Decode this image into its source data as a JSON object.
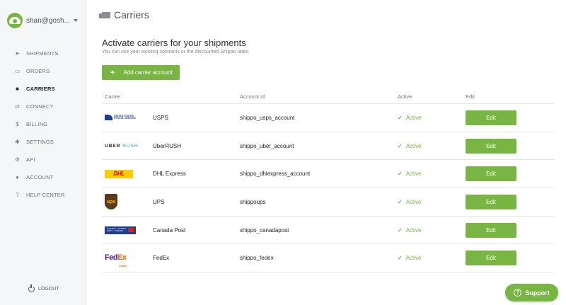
{
  "user": {
    "name": "shan@gosh...",
    "avatar_icon": "shippo-logo-icon"
  },
  "sidebar": {
    "items": [
      {
        "label": "SHIPMENTS",
        "icon": "paper-plane-icon",
        "glyph": "➤"
      },
      {
        "label": "ORDERS",
        "icon": "inbox-icon",
        "glyph": "▭"
      },
      {
        "label": "CARRIERS",
        "icon": "truck-icon",
        "glyph": "■"
      },
      {
        "label": "CONNECT",
        "icon": "exchange-icon",
        "glyph": "⇄"
      },
      {
        "label": "BILLING",
        "icon": "dollar-icon",
        "glyph": "$"
      },
      {
        "label": "SETTINGS",
        "icon": "gear-icon",
        "glyph": "✱"
      },
      {
        "label": "API",
        "icon": "cogs-icon",
        "glyph": "⚙"
      },
      {
        "label": "ACCOUNT",
        "icon": "user-icon",
        "glyph": "●"
      },
      {
        "label": "HELP CENTER",
        "icon": "question-circle-icon",
        "glyph": "?"
      }
    ],
    "active_index": 2,
    "logout_label": "LOGOUT"
  },
  "page": {
    "title": "Carriers",
    "heading": "Activate carriers for your shipments",
    "subheading": "You can use your existing contracts or the discounted Shippo rates.",
    "add_button": {
      "plus": "+",
      "label": "Add carrier account"
    }
  },
  "table": {
    "headers": {
      "carrier": "Carrier",
      "account_id": "Account id",
      "active": "Active",
      "edit": "Edit"
    },
    "rows": [
      {
        "logo": "usps",
        "name": "USPS",
        "account_id": "shippo_usps_account",
        "active": "Active",
        "edit": "Edit"
      },
      {
        "logo": "uber",
        "name": "UberRUSH",
        "account_id": "shippo_uber_account",
        "active": "Active",
        "edit": "Edit"
      },
      {
        "logo": "dhl",
        "name": "DHL Express",
        "account_id": "shippo_dhlexpress_account",
        "active": "Active",
        "edit": "Edit"
      },
      {
        "logo": "ups",
        "name": "UPS",
        "account_id": "shippoups",
        "active": "Active",
        "edit": "Edit"
      },
      {
        "logo": "canadapost",
        "name": "Canada Post",
        "account_id": "shippo_canadapost",
        "active": "Active",
        "edit": "Edit"
      },
      {
        "logo": "fedex",
        "name": "FedEx",
        "account_id": "shippo_fedex",
        "active": "Active",
        "edit": "Edit"
      }
    ]
  },
  "logos": {
    "usps": {
      "line1": "UNITED STATES",
      "line2": "POSTAL SERVICE"
    },
    "uber": {
      "uber": "UBER",
      "rush": "RUSH"
    },
    "dhl": {
      "text": "DHL"
    },
    "ups": {
      "text": "ups"
    },
    "canadapost": {
      "line1": "CANADA · POSTES",
      "line2": "POST · CANADA"
    },
    "fedex": {
      "fed": "Fed",
      "ex": "Ex",
      "sub": "Express"
    }
  },
  "support": {
    "label": "Support",
    "icon": "question-circle-icon",
    "glyph": "?"
  },
  "colors": {
    "accent": "#79b543",
    "sidebar_bg": "#f5f6f7"
  }
}
